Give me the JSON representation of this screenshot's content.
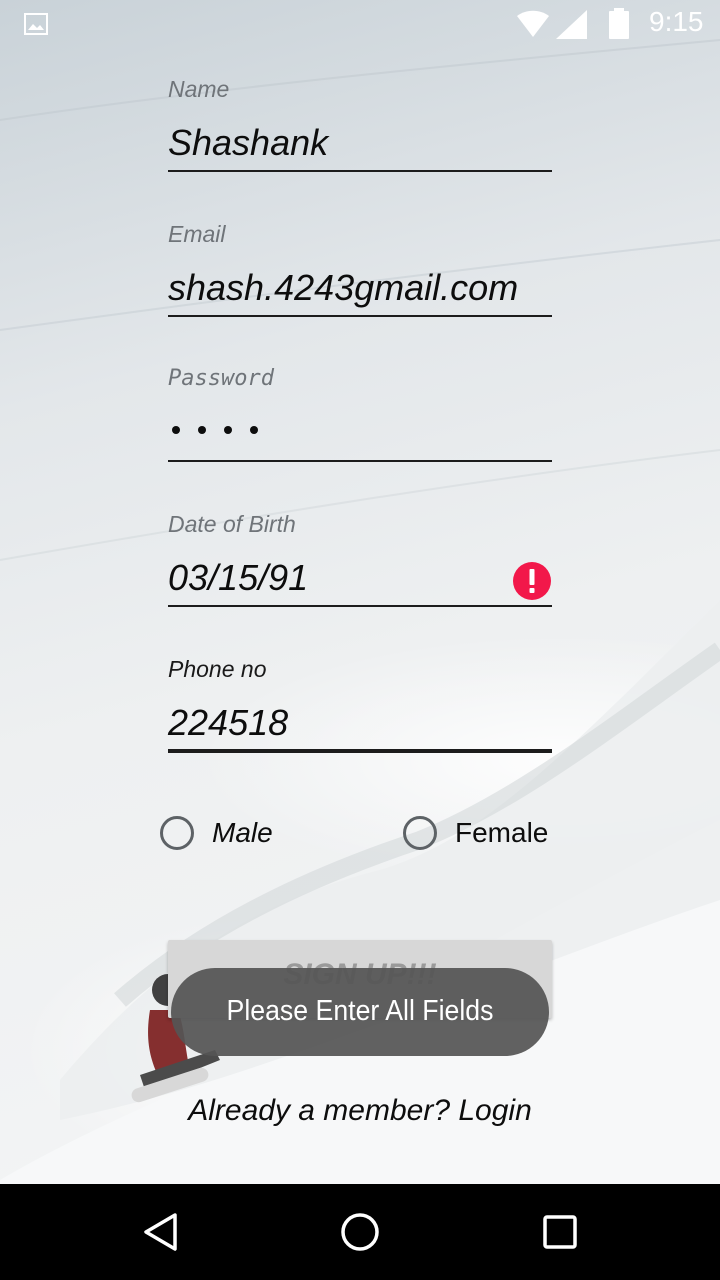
{
  "status_bar": {
    "time": "9:15",
    "icons": [
      "image-icon",
      "wifi-icon",
      "signal-icon",
      "battery-icon"
    ]
  },
  "form": {
    "name": {
      "label": "Name",
      "value": "Shashank"
    },
    "email": {
      "label": "Email",
      "value": "shash.4243gmail.com"
    },
    "password": {
      "label": "Password",
      "masked_length": 4
    },
    "dob": {
      "label": "Date of Birth",
      "value": "03/15/91",
      "error_icon": "error-icon"
    },
    "phone": {
      "label": "Phone no",
      "value": "224518"
    }
  },
  "gender": {
    "options": [
      {
        "label": "Male",
        "selected": false
      },
      {
        "label": "Female",
        "selected": false
      }
    ]
  },
  "signup_button": {
    "label": "SIGN UP!!!"
  },
  "toast": {
    "message": "Please Enter All Fields"
  },
  "login_link": {
    "label": "Already a member? Login"
  },
  "nav_bar": {
    "buttons": [
      "back-icon",
      "home-icon",
      "recents-icon"
    ]
  },
  "colors": {
    "error": "#f2184a",
    "toast_bg": "#555555",
    "button_bg": "#d7d7d7",
    "nav_bg": "#000000"
  }
}
